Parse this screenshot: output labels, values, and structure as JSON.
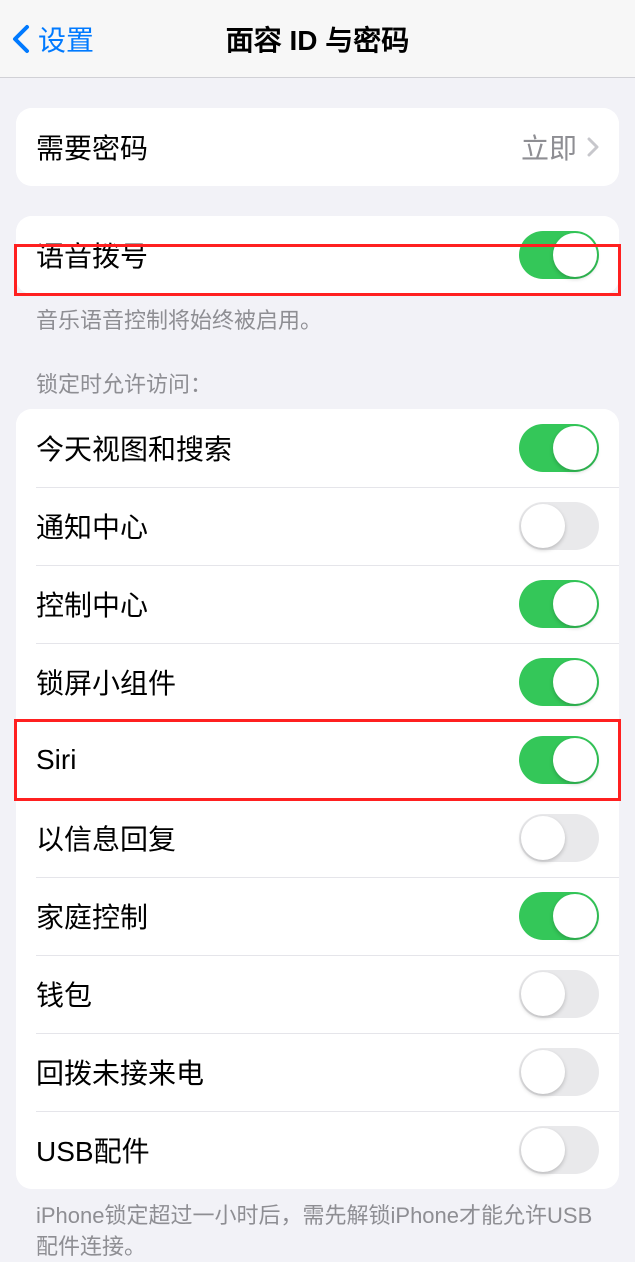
{
  "header": {
    "back_label": "设置",
    "title": "面容 ID 与密码"
  },
  "require_passcode": {
    "label": "需要密码",
    "value": "立即"
  },
  "voice_dial": {
    "label": "语音拨号",
    "enabled": true,
    "footer": "音乐语音控制将始终被启用。"
  },
  "lock_access": {
    "header": "锁定时允许访问：",
    "items": [
      {
        "label": "今天视图和搜索",
        "enabled": true
      },
      {
        "label": "通知中心",
        "enabled": false
      },
      {
        "label": "控制中心",
        "enabled": true
      },
      {
        "label": "锁屏小组件",
        "enabled": true
      },
      {
        "label": "Siri",
        "enabled": true
      },
      {
        "label": "以信息回复",
        "enabled": false
      },
      {
        "label": "家庭控制",
        "enabled": true
      },
      {
        "label": "钱包",
        "enabled": false
      },
      {
        "label": "回拨未接来电",
        "enabled": false
      },
      {
        "label": "USB配件",
        "enabled": false
      }
    ],
    "footer": "iPhone锁定超过一小时后，需先解锁iPhone才能允许USB 配件连接。"
  },
  "highlights": {
    "voice_dial": true,
    "siri_row_index": 4
  },
  "colors": {
    "accent": "#007aff",
    "toggle_on": "#34c759",
    "toggle_off": "#e9e9eb",
    "highlight": "#ff2020"
  }
}
